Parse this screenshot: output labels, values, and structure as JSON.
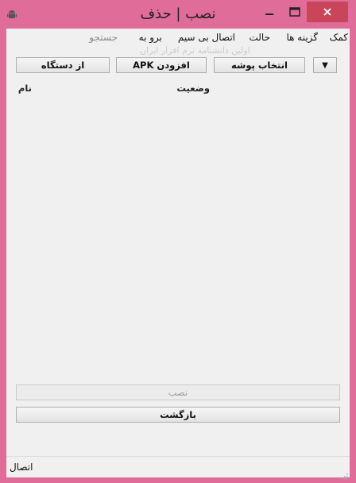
{
  "window": {
    "title": "نصب | حذف",
    "controls": {
      "minimize": "minimize-icon",
      "maximize": "maximize-icon",
      "close": "close-icon"
    },
    "colors": {
      "frame": "#e06c9a",
      "close": "#c8455a",
      "client": "#f0f0f0"
    }
  },
  "menu": {
    "items": [
      {
        "label": "کمک",
        "enabled": true
      },
      {
        "label": "گزینه ها",
        "enabled": true
      },
      {
        "label": "حالت",
        "enabled": true
      },
      {
        "label": "اتصال بی سیم",
        "enabled": true
      },
      {
        "label": "برو به",
        "enabled": true
      },
      {
        "label": "جستجو",
        "enabled": false
      }
    ]
  },
  "watermark": "اولین دانشنامه نرم افزار ایران",
  "toolbar": {
    "from_device": "از دستگاه",
    "add_apk": "افزودن APK",
    "select_folder": "انتخاب پوشه",
    "dropdown_arrow": "▼"
  },
  "list": {
    "columns": [
      "نام",
      "وضعیت"
    ]
  },
  "actions": {
    "install": "نصب",
    "back": "بازگشت"
  },
  "status": {
    "text": "اتصال"
  }
}
